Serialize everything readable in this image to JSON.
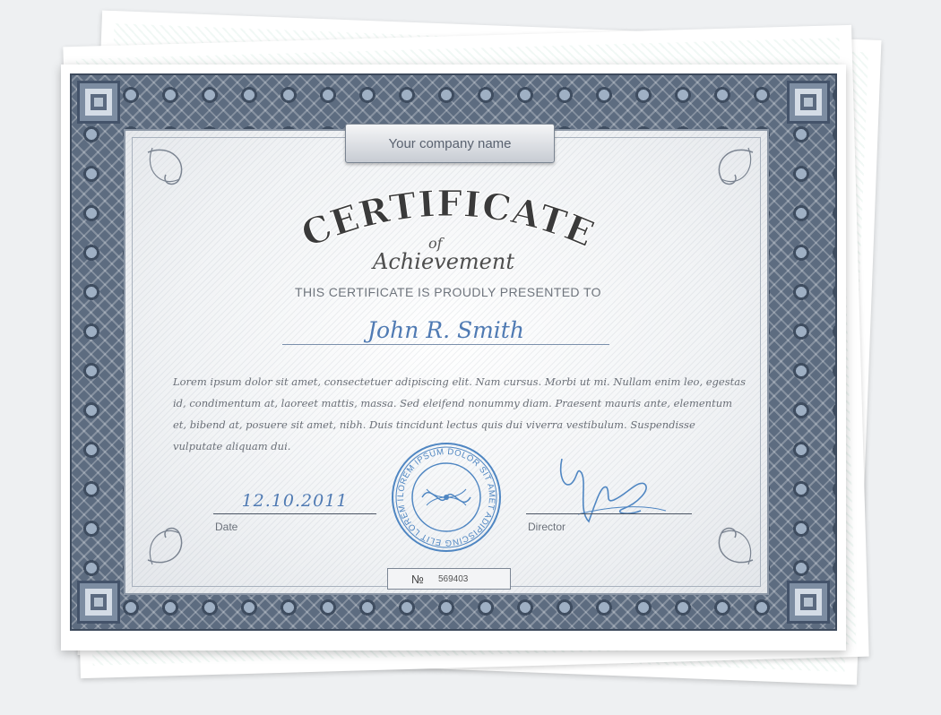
{
  "certificate": {
    "company_name": "Your company name",
    "title": "CERTIFICATE",
    "of": "of",
    "subtitle": "Achievement",
    "presented_to": "THIS CERTIFICATE IS PROUDLY PRESENTED TO",
    "recipient": "John R. Smith",
    "body": "Lorem ipsum dolor sit amet, consectetuer adipiscing elit. Nam cursus. Morbi ut mi. Nullam enim leo, egestas id, condimentum at, laoreet mattis, massa. Sed eleifend nonummy diam. Praesent mauris ante, elementum et, bibend at, posuere sit amet, nibh. Duis tincidunt lectus quis dui viverra vestibulum. Suspendisse vulputate aliquam dui.",
    "date_value": "12.10.2011",
    "date_label": "Date",
    "director_label": "Director",
    "seal_text": "LOREM IPSUM DOLOR SIT AMET ADIPISCING ELIT LOREM IPSUM DOLOR",
    "number_sign": "№",
    "number": "569403"
  },
  "colors": {
    "frame": "#5d6c80",
    "accent_blue": "#4f7ab3",
    "title_gray": "#4a4a4a"
  },
  "icons": {
    "seal": "stamp-seal-icon",
    "signature": "handwritten-signature-icon",
    "corner": "ornament-corner-icon"
  }
}
